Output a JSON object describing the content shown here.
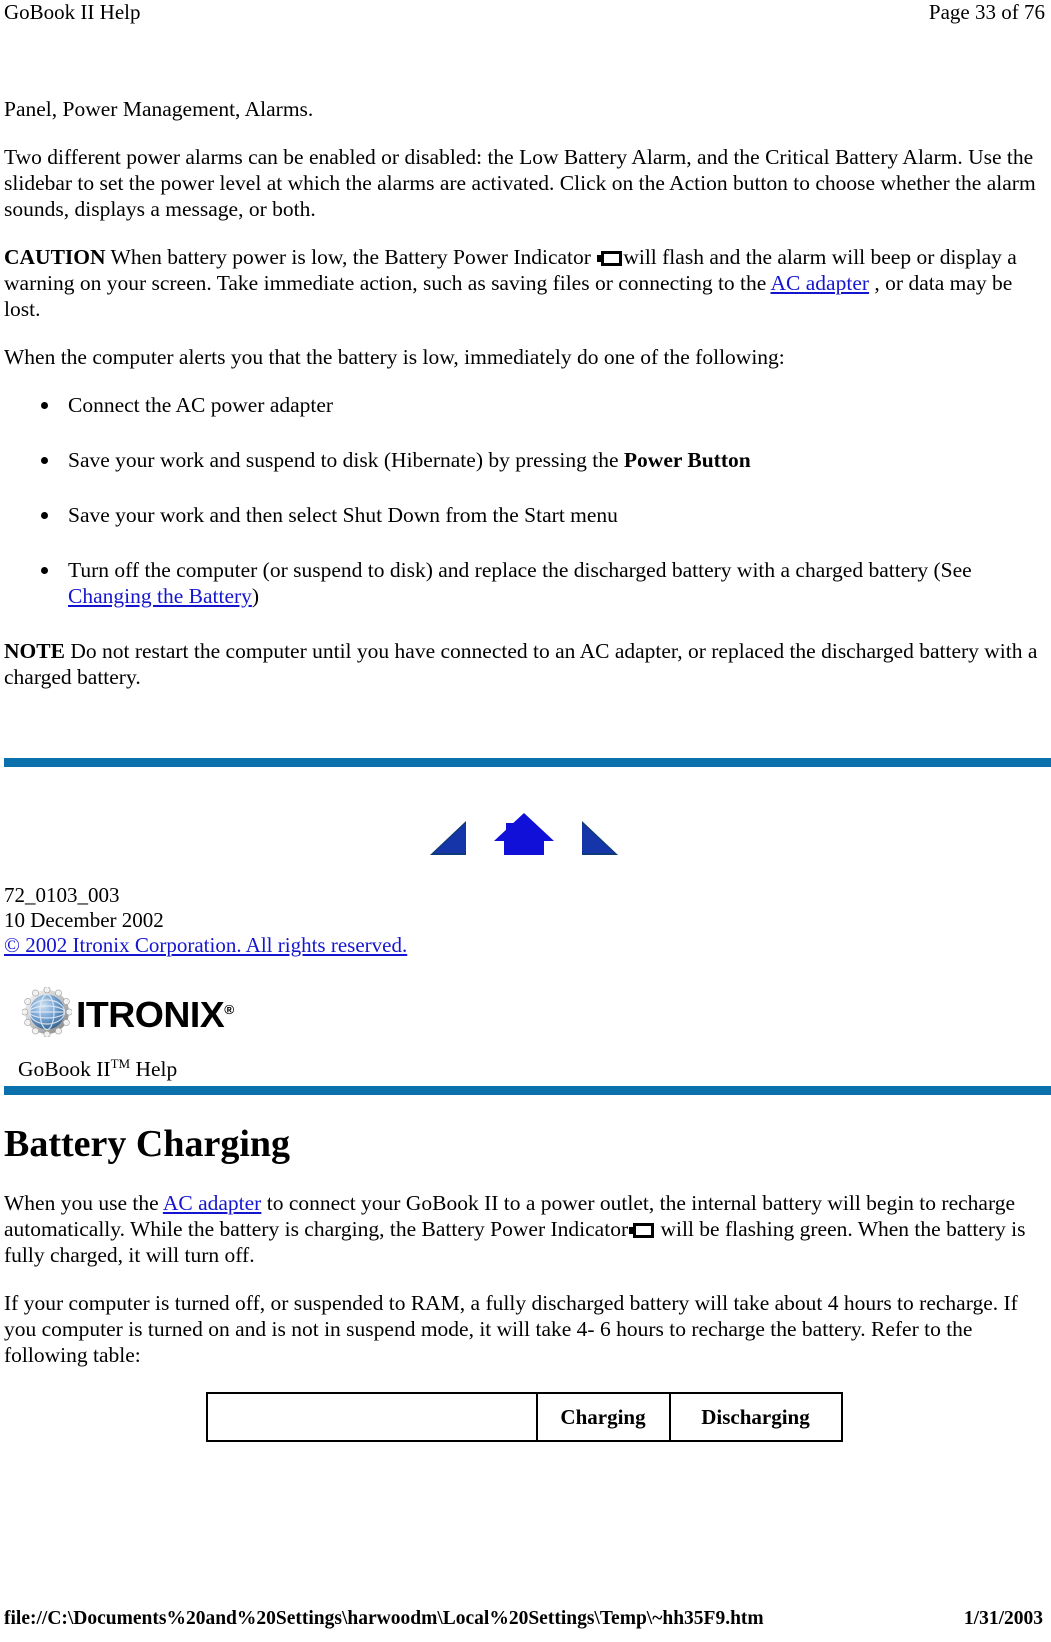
{
  "header": {
    "title": "GoBook II Help",
    "page_label": "Page 33 of 76"
  },
  "body": {
    "para_panel": "Panel, Power Management, Alarms.",
    "para_alarms": "Two different power alarms can be enabled or disabled: the Low Battery Alarm, and the Critical Battery Alarm.  Use the slidebar to set the power level at which the alarms are activated.  Click on the Action button to choose whether the alarm sounds, displays a message, or both.",
    "caution_label": "CAUTION",
    "caution_text_1": "  When battery power is low, the Battery Power Indicator ",
    "caution_text_2": "will flash and the alarm will beep or display a warning on your screen. Take immediate action, such as saving files or connecting to the ",
    "caution_link": "AC adapter",
    "caution_text_3": " , or data may be lost.",
    "para_alert_intro": "When the computer alerts you that the battery is low, immediately do one of the following:",
    "bullets": [
      {
        "text": "Connect the AC power adapter"
      },
      {
        "pre": "Save your work and suspend to disk (Hibernate) by pressing the ",
        "bold": "Power Button",
        "post": ""
      },
      {
        "text": "Save your work and then select Shut Down from the Start menu"
      },
      {
        "pre": "Turn off the computer (or suspend to disk) and replace the discharged battery with a charged battery (See ",
        "link": "Changing the Battery",
        "post": ")"
      }
    ],
    "note_label": "NOTE",
    "note_text": "  Do not restart the computer until you have connected to an AC adapter, or replaced the discharged battery with a charged battery."
  },
  "nav": {
    "back_label": "back-arrow",
    "home_label": "home",
    "forward_label": "forward-arrow"
  },
  "meta": {
    "doc_number": "72_0103_003",
    "doc_date": "10 December 2002",
    "copyright": "© 2002 Itronix Corporation.  All rights reserved."
  },
  "brand": {
    "logo_word": "ITRONIX",
    "logo_reg": "®",
    "product_line": "GoBook II",
    "product_tm": "TM",
    "product_suffix": " Help"
  },
  "section": {
    "title": "Battery Charging",
    "para_1_pre": "When you use the ",
    "para_1_link": "AC adapter",
    "para_1_mid": " to connect your GoBook II to a power outlet, the internal battery will begin to recharge automatically. While the battery is charging, the Battery Power Indicator",
    "para_1_post": "  will be flashing green. When the battery is fully charged, it will turn off.",
    "para_2": "If your computer is turned off, or suspended to RAM, a fully discharged battery will take about 4 hours to recharge.  If you computer is turned on and is not in suspend mode, it will take 4- 6 hours to recharge the battery.  Refer to the following table:"
  },
  "table": {
    "headers": [
      "",
      "Charging",
      "Discharging"
    ],
    "rows": []
  },
  "footer": {
    "path": "file://C:\\Documents%20and%20Settings\\harwoodm\\Local%20Settings\\Temp\\~hh35F9.htm",
    "date": "1/31/2003"
  },
  "colors": {
    "divider_blue": "#0a71ad",
    "link_blue": "#1515cf",
    "nav_blue": "#1010d8",
    "nav_blue_dark": "#0d3a78"
  }
}
